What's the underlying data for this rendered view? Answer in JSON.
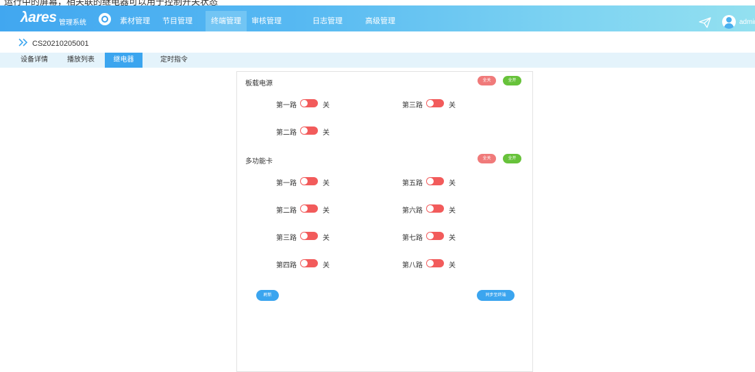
{
  "top_overflow_text": "运行中的屏幕，相关联的继电器可以用于控制开关状态",
  "header": {
    "logo_text": "λares",
    "logo_subtitle": "管理系统",
    "nav": [
      {
        "label": "素材管理"
      },
      {
        "label": "节目管理"
      },
      {
        "label": "终端管理"
      },
      {
        "label": "审核管理"
      },
      {
        "label": "日志管理"
      },
      {
        "label": "高级管理"
      }
    ],
    "active_nav": "终端管理",
    "username": "admin"
  },
  "breadcrumb": {
    "device_id": "CS20210205001"
  },
  "tabs": [
    {
      "label": "设备详情"
    },
    {
      "label": "播放列表"
    },
    {
      "label": "继电器"
    },
    {
      "label": "定时指令"
    }
  ],
  "active_tab": "继电器",
  "board_power": {
    "title": "板载电源",
    "all_off_label": "全关",
    "all_on_label": "全开",
    "relays": [
      {
        "label": "第一路",
        "state": "关",
        "on": false
      },
      {
        "label": "第三路",
        "state": "关",
        "on": false
      },
      {
        "label": "第二路",
        "state": "关",
        "on": false
      }
    ]
  },
  "multi_card": {
    "title": "多功能卡",
    "all_off_label": "全关",
    "all_on_label": "全开",
    "relays": [
      {
        "label": "第一路",
        "state": "关",
        "on": false
      },
      {
        "label": "第五路",
        "state": "关",
        "on": false
      },
      {
        "label": "第二路",
        "state": "关",
        "on": false
      },
      {
        "label": "第六路",
        "state": "关",
        "on": false
      },
      {
        "label": "第三路",
        "state": "关",
        "on": false
      },
      {
        "label": "第七路",
        "state": "关",
        "on": false
      },
      {
        "label": "第四路",
        "state": "关",
        "on": false
      },
      {
        "label": "第八路",
        "state": "关",
        "on": false
      }
    ]
  },
  "actions": {
    "refresh_label": "刷新",
    "sync_label": "同步至终端"
  },
  "colors": {
    "nav_gradient_start": "#41a7f0",
    "nav_gradient_end": "#93e0f0",
    "accent": "#3ba5ef",
    "switch_off": "#f25b5b",
    "all_off": "#f07a7a",
    "all_on": "#67c23a"
  }
}
